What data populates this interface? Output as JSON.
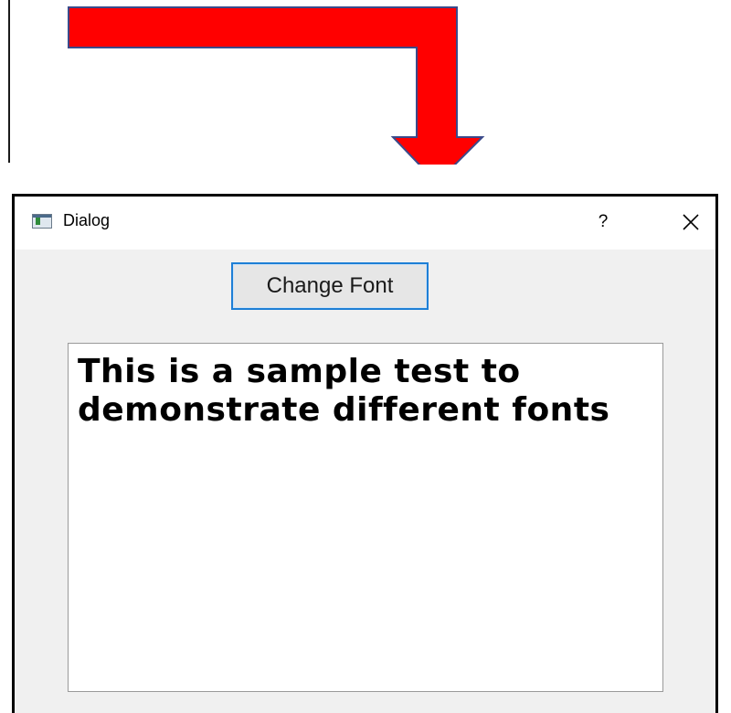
{
  "background_graphic": {
    "arrow_color": "#ff0000",
    "arrow_outline_color": "#3b4a8a",
    "arrow_icon": "bent-arrow-down-icon"
  },
  "dialog": {
    "title": "Dialog",
    "app_icon": "window-app-icon",
    "help_label": "?",
    "close_icon": "close-icon",
    "change_font_label": "Change Font",
    "text_content": "This is a sample test to\ndemonstrate different fonts",
    "accent_color": "#1e7fd6"
  }
}
